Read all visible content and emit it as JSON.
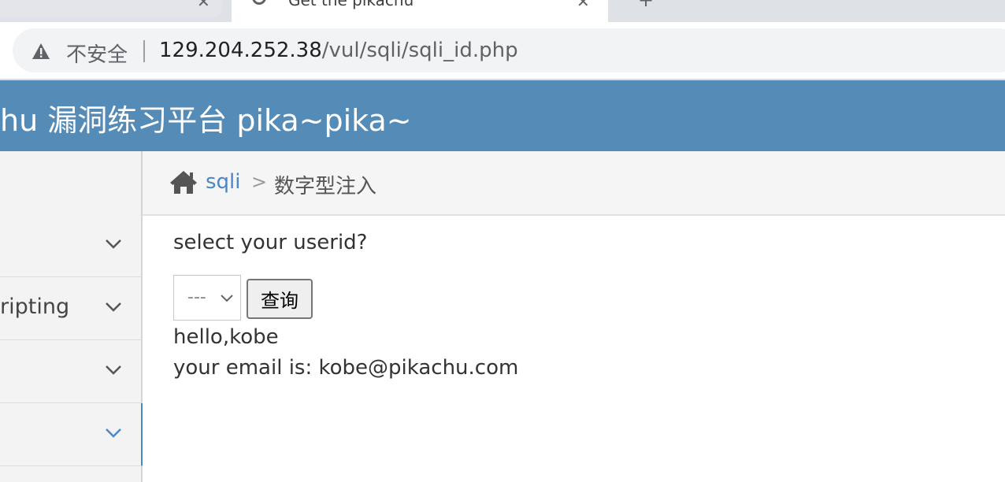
{
  "browser": {
    "tabs": [
      {
        "title": ""
      },
      {
        "title": "Get the pikachu"
      }
    ],
    "security_label": "不安全",
    "url_host": "129.204.252.38",
    "url_path": "/vul/sqli/sqli_id.php"
  },
  "site": {
    "title": "hu 漏洞练习平台 pika~pika~"
  },
  "sidebar": {
    "items": [
      {
        "label": ""
      },
      {
        "label": "ripting"
      },
      {
        "label": ""
      },
      {
        "label": ""
      }
    ],
    "active_color": "#4a86c8"
  },
  "breadcrumb": {
    "link": "sqli",
    "separator": ">",
    "current": "数字型注入"
  },
  "form": {
    "prompt": "select your userid?",
    "select_value": "---",
    "submit_label": "查询"
  },
  "result": {
    "greeting": "hello,kobe",
    "email_line": "your email is: kobe@pikachu.com"
  },
  "colors": {
    "header_bg": "#558bb7",
    "link": "#4a86c8"
  }
}
